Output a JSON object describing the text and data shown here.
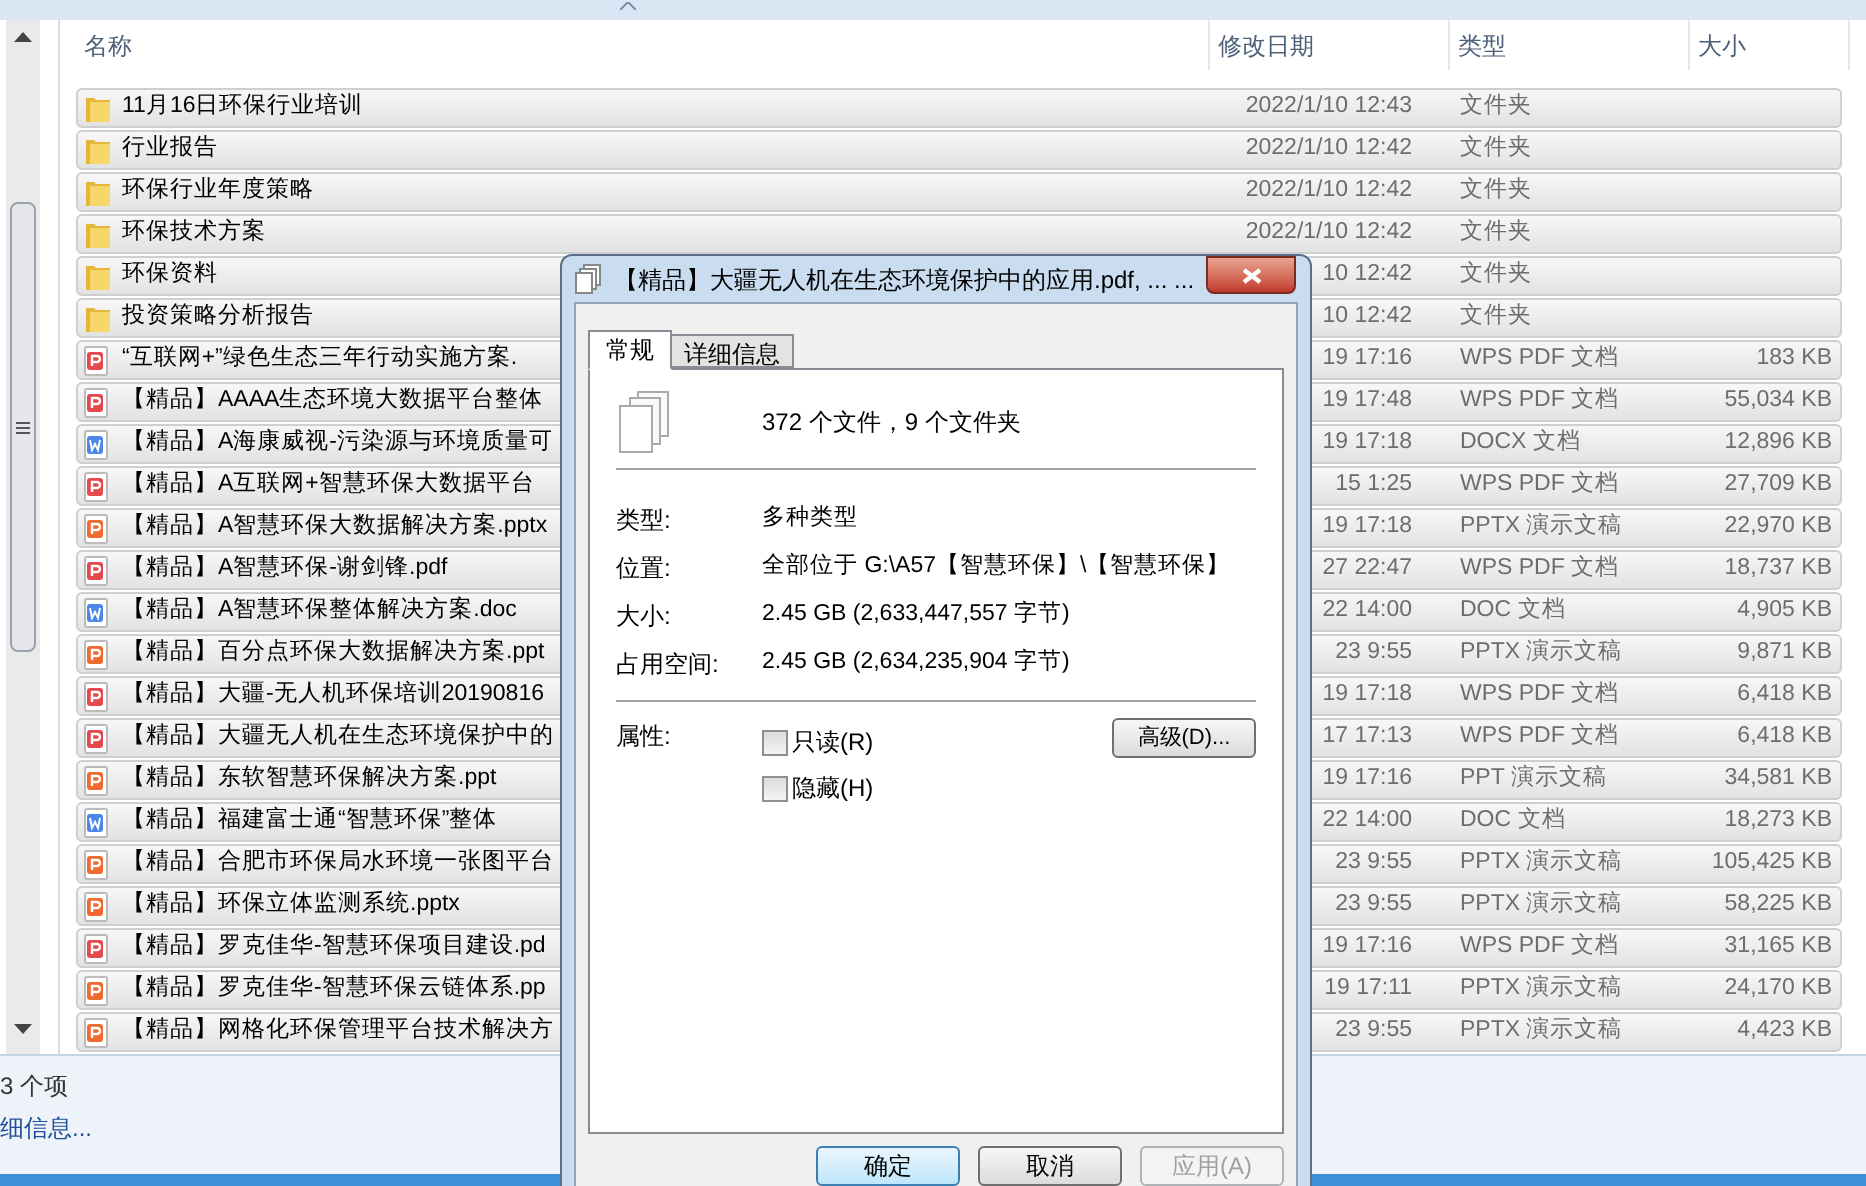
{
  "explorer": {
    "columns": [
      "名称",
      "修改日期",
      "类型",
      "大小"
    ],
    "rows": [
      {
        "name": "11月16日环保行业培训",
        "date": "2022/1/10 12:43",
        "type": "文件夹",
        "kind": "folder",
        "selected": true
      },
      {
        "name": "行业报告",
        "date": "2022/1/10 12:42",
        "type": "文件夹",
        "kind": "folder",
        "selected": true
      },
      {
        "name": "环保行业年度策略",
        "date": "2022/1/10 12:42",
        "type": "文件夹",
        "kind": "folder",
        "selected": true
      },
      {
        "name": "环保技术方案",
        "date": "2022/1/10 12:42",
        "type": "文件夹",
        "kind": "folder",
        "selected": true
      },
      {
        "name": "环保资料",
        "date": "10 12:42",
        "type": "文件夹",
        "kind": "folder",
        "selected": true
      },
      {
        "name": "投资策略分析报告",
        "date": "10 12:42",
        "type": "文件夹",
        "kind": "folder",
        "selected": true
      },
      {
        "name": "“互联网+”绿色生态三年行动实施方案.",
        "date": "19 17:16",
        "type": "WPS PDF 文档",
        "size": "183 KB",
        "kind": "pdf",
        "selected": true
      },
      {
        "name": "【精品】AAAA生态环境大数据平台整体",
        "date": "19 17:48",
        "type": "WPS PDF 文档",
        "size": "55,034 KB",
        "kind": "pdf",
        "selected": true
      },
      {
        "name": "【精品】A海康威视-污染源与环境质量可",
        "date": "19 17:18",
        "type": "DOCX 文档",
        "size": "12,896 KB",
        "kind": "doc",
        "selected": true
      },
      {
        "name": "【精品】A互联网+智慧环保大数据平台",
        "date": "15 1:25",
        "type": "WPS PDF 文档",
        "size": "27,709 KB",
        "kind": "pdf",
        "selected": true
      },
      {
        "name": "【精品】A智慧环保大数据解决方案.pptx",
        "date": "19 17:18",
        "type": "PPTX 演示文稿",
        "size": "22,970 KB",
        "kind": "ppt",
        "selected": true
      },
      {
        "name": "【精品】A智慧环保-谢剑锋.pdf",
        "date": "27 22:47",
        "type": "WPS PDF 文档",
        "size": "18,737 KB",
        "kind": "pdf",
        "selected": true
      },
      {
        "name": "【精品】A智慧环保整体解决方案.doc",
        "date": "22 14:00",
        "type": "DOC 文档",
        "size": "4,905 KB",
        "kind": "doc",
        "selected": true
      },
      {
        "name": "【精品】百分点环保大数据解决方案.ppt",
        "date": "23 9:55",
        "type": "PPTX 演示文稿",
        "size": "9,871 KB",
        "kind": "ppt",
        "selected": true
      },
      {
        "name": "【精品】大疆-无人机环保培训20190816",
        "date": "19 17:18",
        "type": "WPS PDF 文档",
        "size": "6,418 KB",
        "kind": "pdf",
        "selected": true
      },
      {
        "name": "【精品】大疆无人机在生态环境保护中的",
        "date": "17 17:13",
        "type": "WPS PDF 文档",
        "size": "6,418 KB",
        "kind": "pdf",
        "selected": true
      },
      {
        "name": "【精品】东软智慧环保解决方案.ppt",
        "date": "19 17:16",
        "type": "PPT 演示文稿",
        "size": "34,581 KB",
        "kind": "ppt",
        "selected": true
      },
      {
        "name": "【精品】福建富士通“智慧环保”整体",
        "date": "22 14:00",
        "type": "DOC 文档",
        "size": "18,273 KB",
        "kind": "doc",
        "selected": true
      },
      {
        "name": "【精品】合肥市环保局水环境一张图平台",
        "date": "23 9:55",
        "type": "PPTX 演示文稿",
        "size": "105,425 KB",
        "kind": "ppt",
        "selected": true
      },
      {
        "name": "【精品】环保立体监测系统.pptx",
        "date": "23 9:55",
        "type": "PPTX 演示文稿",
        "size": "58,225 KB",
        "kind": "ppt",
        "selected": true
      },
      {
        "name": "【精品】罗克佳华-智慧环保项目建设.pd",
        "date": "19 17:16",
        "type": "WPS PDF 文档",
        "size": "31,165 KB",
        "kind": "pdf",
        "selected": true
      },
      {
        "name": "【精品】罗克佳华-智慧环保云链体系.pp",
        "date": "19 17:11",
        "type": "PPTX 演示文稿",
        "size": "24,170 KB",
        "kind": "ppt",
        "selected": true
      },
      {
        "name": "【精品】网格化环保管理平台技术解决方",
        "date": "23 9:55",
        "type": "PPTX 演示文稿",
        "size": "4,423 KB",
        "kind": "ppt",
        "selected": true
      }
    ],
    "status": {
      "item_count": "3 个项",
      "details_link": "细信息..."
    }
  },
  "dialog": {
    "title": "【精品】大疆无人机在生态环境保护中的应用.pdf, ... ...",
    "tabs": [
      {
        "label": "常规",
        "selected": true
      },
      {
        "label": "详细信息",
        "selected": false
      }
    ],
    "summary": "372 个文件，9 个文件夹",
    "properties": [
      {
        "label": "类型:",
        "value": "多种类型"
      },
      {
        "label": "位置:",
        "value": "全部位于 G:\\A57【智慧环保】\\【智慧环保】"
      },
      {
        "label": "大小:",
        "value": "2.45 GB (2,633,447,557 字节)"
      },
      {
        "label": "占用空间:",
        "value": "2.45 GB (2,634,235,904 字节)"
      }
    ],
    "attributes_label": "属性:",
    "checkboxes": [
      {
        "label": "只读(R)",
        "checked": false
      },
      {
        "label": "隐藏(H)",
        "checked": false
      }
    ],
    "advanced_button": "高级(D)...",
    "buttons": [
      {
        "label": "确定",
        "default": true,
        "disabled": false
      },
      {
        "label": "取消",
        "default": false,
        "disabled": false
      },
      {
        "label": "应用(A)",
        "default": false,
        "disabled": true
      }
    ]
  }
}
